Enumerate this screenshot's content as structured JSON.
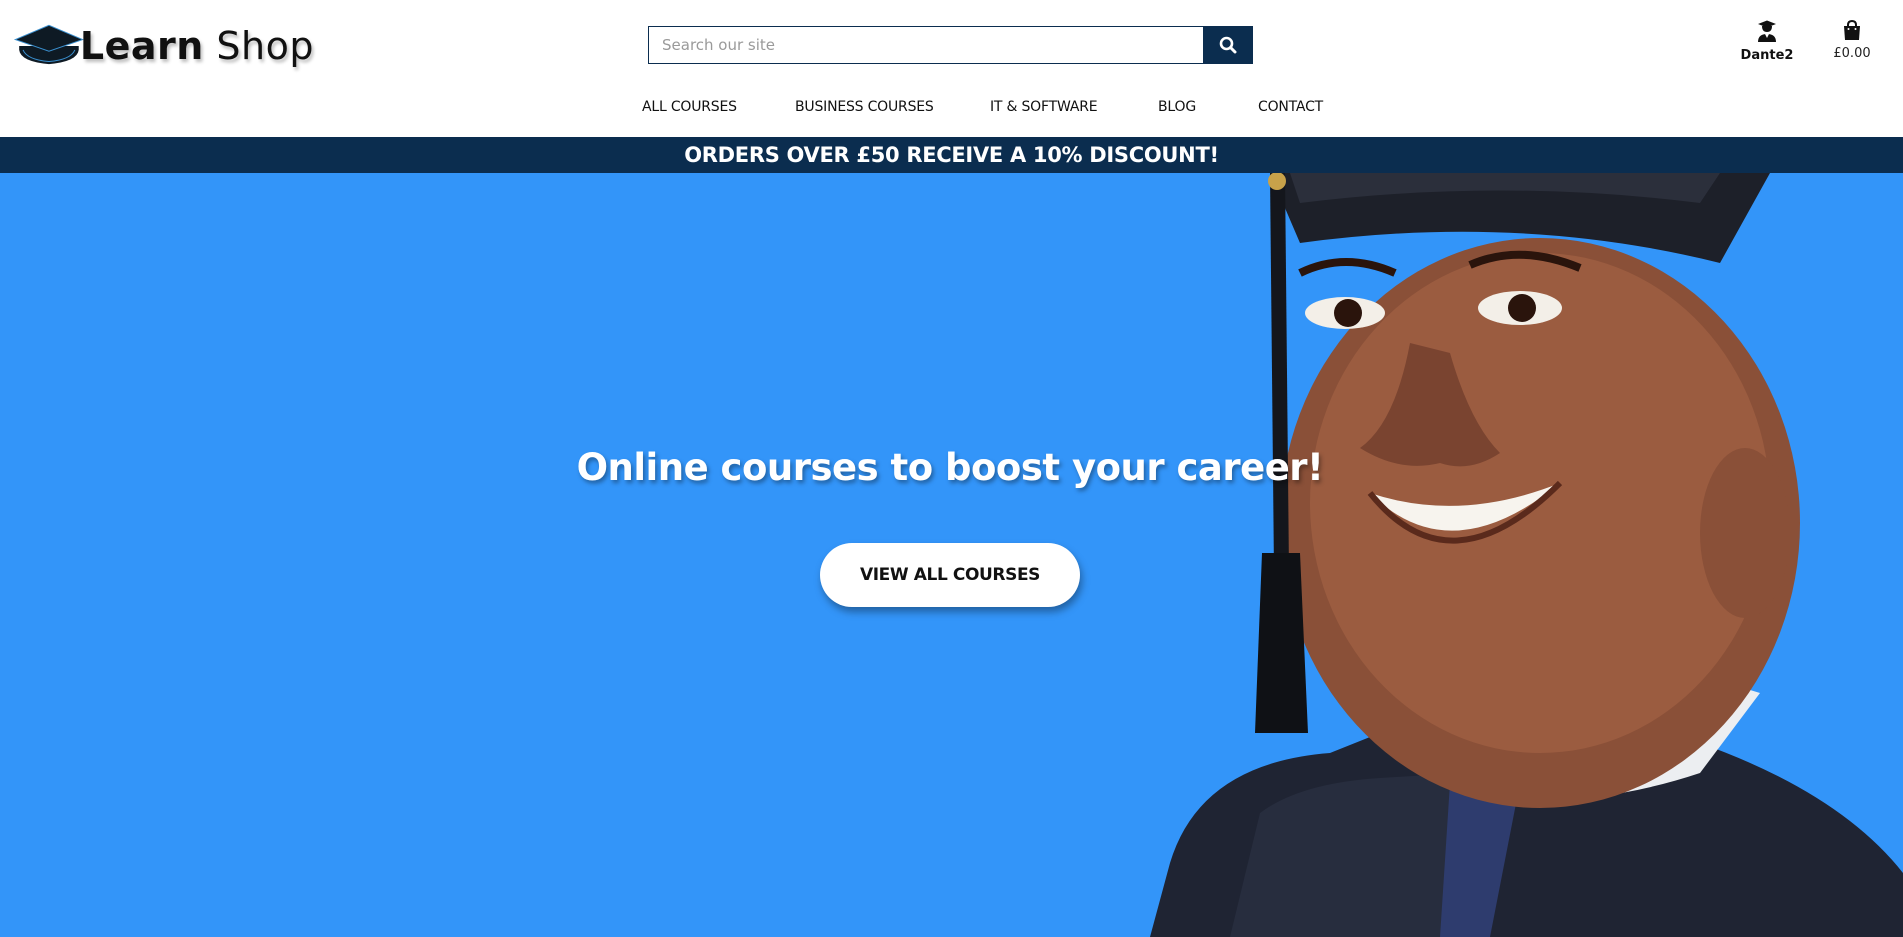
{
  "logo": {
    "word1": "Learn",
    "word2": "Shop",
    "icon": "graduation-cap-icon"
  },
  "search": {
    "placeholder": "Search our site",
    "value": "",
    "icon": "search-icon"
  },
  "account": {
    "icon": "user-graduate-icon",
    "label": "Dante2"
  },
  "bag": {
    "icon": "shopping-bag-icon",
    "label": "£0.00"
  },
  "nav": {
    "items": [
      {
        "label": "ALL COURSES"
      },
      {
        "label": "BUSINESS COURSES"
      },
      {
        "label": "IT & SOFTWARE"
      },
      {
        "label": "BLOG"
      },
      {
        "label": "CONTACT"
      }
    ]
  },
  "promo": {
    "text": "ORDERS OVER £50 RECEIVE A 10% DISCOUNT!"
  },
  "hero": {
    "headline_before": "Online courses to ",
    "headline_bold": "boost",
    "headline_after": " your career!",
    "button_label": "VIEW ALL COURSES",
    "image": "graduate-photo"
  },
  "colors": {
    "navy": "#0b2d4f",
    "hero_blue": "#3395f9",
    "white": "#ffffff"
  }
}
